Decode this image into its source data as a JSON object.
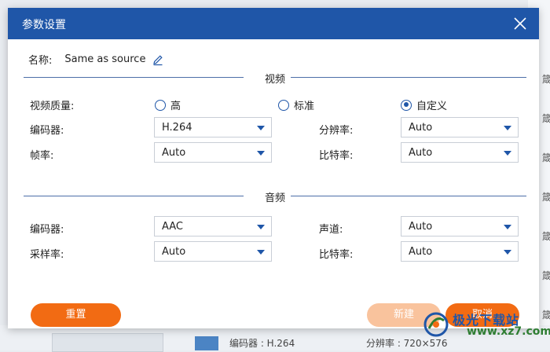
{
  "dialog": {
    "title": "参数设置",
    "name_label": "名称:",
    "name_value": "Same as source"
  },
  "video": {
    "section_title": "视频",
    "quality_label": "视频质量:",
    "quality_options": [
      "高",
      "标准",
      "自定义"
    ],
    "quality_selected": "自定义",
    "encoder_label": "编码器:",
    "encoder_value": "H.264",
    "resolution_label": "分辨率:",
    "resolution_value": "Auto",
    "framerate_label": "帧率:",
    "framerate_value": "Auto",
    "bitrate_label": "比特率:",
    "bitrate_value": "Auto"
  },
  "audio": {
    "section_title": "音频",
    "encoder_label": "编码器:",
    "encoder_value": "AAC",
    "channel_label": "声道:",
    "channel_value": "Auto",
    "samplerate_label": "采样率:",
    "samplerate_value": "Auto",
    "bitrate_label": "比特率:",
    "bitrate_value": "Auto"
  },
  "buttons": {
    "reset": "重置",
    "new": "新建",
    "cancel": "取消"
  },
  "background": {
    "right_glyphs": [
      "箴",
      "箴",
      "箴",
      "箴",
      "箴",
      "箴",
      "箴",
      "箴"
    ],
    "bottom_encoder": "编码器 : H.264",
    "bottom_resolution": "分辨率 : 720×576"
  },
  "watermark": {
    "site_name": "极光下载站",
    "site_url": "www.xz7.com"
  },
  "colors": {
    "titlebar": "#1f56a8",
    "accent_orange": "#f26b13",
    "disabled_orange": "#f9c39d"
  }
}
